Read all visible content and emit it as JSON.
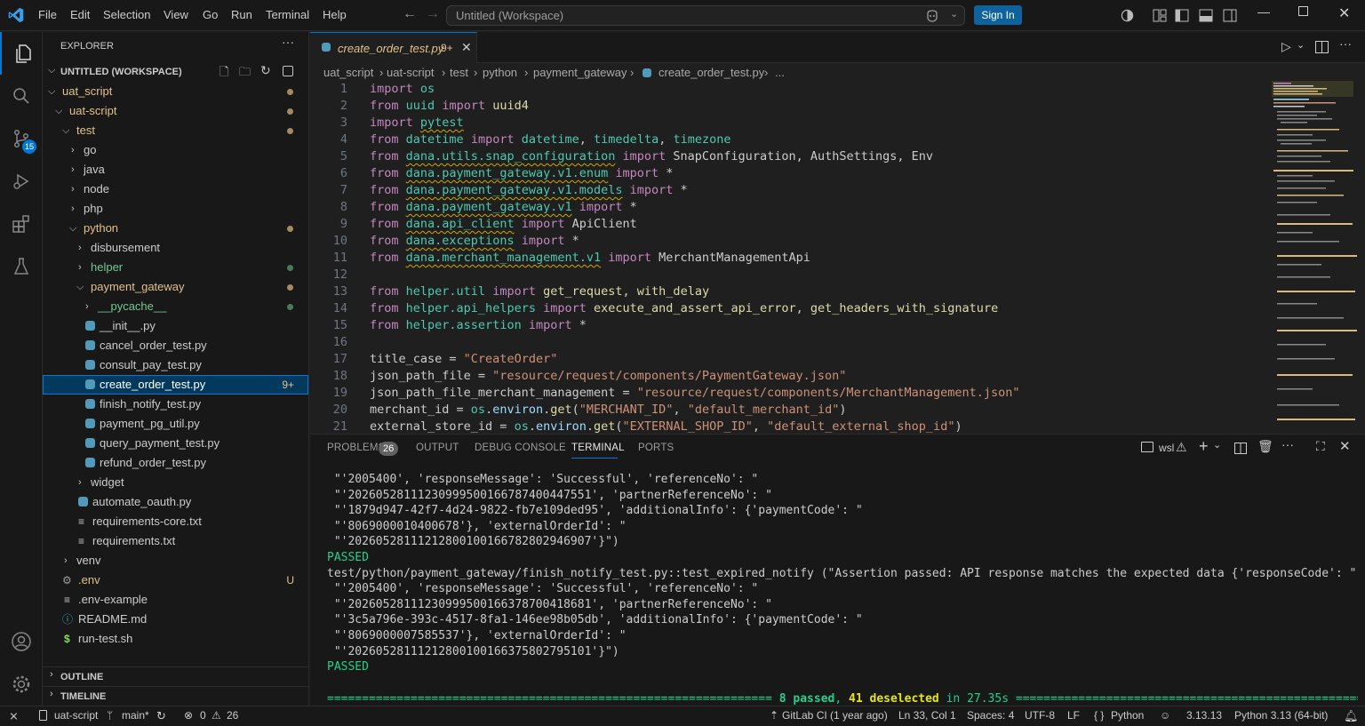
{
  "titlebar": {
    "menus": [
      "File",
      "Edit",
      "Selection",
      "View",
      "Go",
      "Run",
      "Terminal",
      "Help"
    ],
    "search_text": "Untitled (Workspace)",
    "signin_label": "Sign In"
  },
  "activity": {
    "scm_badge": "15"
  },
  "sidebar": {
    "title": "EXPLORER",
    "workspace": "UNTITLED (WORKSPACE)",
    "rows": [
      {
        "label": "uat_script",
        "depth": 1,
        "kind": "folder-open",
        "color": "#e2c08d",
        "dot": "#a68a5f"
      },
      {
        "label": "uat-script",
        "depth": 2,
        "kind": "folder-open",
        "color": "#e2c08d",
        "dot": "#a68a5f"
      },
      {
        "label": "test",
        "depth": 3,
        "kind": "folder-open",
        "color": "#e2c08d",
        "dot": "#a68a5f"
      },
      {
        "label": "go",
        "depth": 4,
        "kind": "folder",
        "color": "#cccccc"
      },
      {
        "label": "java",
        "depth": 4,
        "kind": "folder",
        "color": "#cccccc"
      },
      {
        "label": "node",
        "depth": 4,
        "kind": "folder",
        "color": "#cccccc"
      },
      {
        "label": "php",
        "depth": 4,
        "kind": "folder",
        "color": "#cccccc"
      },
      {
        "label": "python",
        "depth": 4,
        "kind": "folder-open",
        "color": "#e2c08d",
        "dot": "#a68a5f"
      },
      {
        "label": "disbursement",
        "depth": 5,
        "kind": "folder",
        "color": "#cccccc"
      },
      {
        "label": "helper",
        "depth": 5,
        "kind": "folder",
        "color": "#73c991",
        "dot": "#4b7a5a"
      },
      {
        "label": "payment_gateway",
        "depth": 5,
        "kind": "folder-open",
        "color": "#e2c08d",
        "dot": "#a68a5f"
      },
      {
        "label": "__pycache__",
        "depth": 6,
        "kind": "folder",
        "color": "#73c991",
        "dot": "#4b7a5a"
      },
      {
        "label": "__init__.py",
        "depth": 6,
        "kind": "py",
        "color": "#cccccc"
      },
      {
        "label": "cancel_order_test.py",
        "depth": 6,
        "kind": "py",
        "color": "#cccccc"
      },
      {
        "label": "consult_pay_test.py",
        "depth": 6,
        "kind": "py",
        "color": "#cccccc"
      },
      {
        "label": "create_order_test.py",
        "depth": 6,
        "kind": "py",
        "color": "#ffffff",
        "selected": true,
        "badge": "9+"
      },
      {
        "label": "finish_notify_test.py",
        "depth": 6,
        "kind": "py",
        "color": "#cccccc"
      },
      {
        "label": "payment_pg_util.py",
        "depth": 6,
        "kind": "py",
        "color": "#cccccc"
      },
      {
        "label": "query_payment_test.py",
        "depth": 6,
        "kind": "py",
        "color": "#cccccc"
      },
      {
        "label": "refund_order_test.py",
        "depth": 6,
        "kind": "py",
        "color": "#cccccc"
      },
      {
        "label": "widget",
        "depth": 5,
        "kind": "folder",
        "color": "#cccccc"
      },
      {
        "label": "automate_oauth.py",
        "depth": 5,
        "kind": "py",
        "color": "#cccccc"
      },
      {
        "label": "requirements-core.txt",
        "depth": 5,
        "kind": "txt",
        "color": "#cccccc"
      },
      {
        "label": "requirements.txt",
        "depth": 5,
        "kind": "txt",
        "color": "#cccccc"
      },
      {
        "label": "venv",
        "depth": 3,
        "kind": "folder",
        "color": "#cccccc"
      },
      {
        "label": ".env",
        "depth": 3,
        "kind": "gear",
        "color": "#e2c08d",
        "badge": "U"
      },
      {
        "label": ".env-example",
        "depth": 3,
        "kind": "txt",
        "color": "#cccccc"
      },
      {
        "label": "README.md",
        "depth": 3,
        "kind": "info",
        "color": "#cccccc"
      },
      {
        "label": "run-test.sh",
        "depth": 3,
        "kind": "sh",
        "color": "#cccccc"
      }
    ],
    "outline": "OUTLINE",
    "timeline": "TIMELINE"
  },
  "tab": {
    "label": "create_order_test.py",
    "badge": "9+"
  },
  "breadcrumb": [
    "uat_script",
    "uat-script",
    "test",
    "python",
    "payment_gateway",
    "create_order_test.py",
    "..."
  ],
  "code": [
    {
      "n": "1",
      "html": "<span class='kw'>import</span> <span class='mod'>os</span>"
    },
    {
      "n": "2",
      "html": "<span class='kw'>from</span> <span class='mod'>uuid</span> <span class='kw'>import</span> <span class='fn'>uuid4</span>"
    },
    {
      "n": "3",
      "html": "<span class='kw'>import</span> <span class='mod wavy'>pytest</span>"
    },
    {
      "n": "4",
      "html": "<span class='kw'>from</span> <span class='mod'>datetime</span> <span class='kw'>import</span> <span class='cls'>datetime</span>, <span class='cls'>timedelta</span>, <span class='cls'>timezone</span>"
    },
    {
      "n": "5",
      "html": "<span class='kw'>from</span> <span class='mod wavy'>dana.utils.snap_configuration</span> <span class='kw'>import</span> SnapConfiguration, AuthSettings, Env"
    },
    {
      "n": "6",
      "html": "<span class='kw'>from</span> <span class='mod wavy'>dana.payment_gateway.v1.enum</span> <span class='kw'>import</span> *"
    },
    {
      "n": "7",
      "html": "<span class='kw'>from</span> <span class='mod wavy'>dana.payment_gateway.v1.models</span> <span class='kw'>import</span> *"
    },
    {
      "n": "8",
      "html": "<span class='kw'>from</span> <span class='mod wavy'>dana.payment_gateway.v1</span> <span class='kw'>import</span> *"
    },
    {
      "n": "9",
      "html": "<span class='kw'>from</span> <span class='mod wavy'>dana.api_client</span> <span class='kw'>import</span> ApiClient"
    },
    {
      "n": "10",
      "html": "<span class='kw'>from</span> <span class='mod wavy'>dana.exceptions</span> <span class='kw'>import</span> *"
    },
    {
      "n": "11",
      "html": "<span class='kw'>from</span> <span class='mod wavy'>dana.merchant_management.v1</span> <span class='kw'>import</span> MerchantManagementApi"
    },
    {
      "n": "12",
      "html": ""
    },
    {
      "n": "13",
      "html": "<span class='kw'>from</span> <span class='mod'>helper.util</span> <span class='kw'>import</span> <span class='fn'>get_request</span>, <span class='fn'>with_delay</span>"
    },
    {
      "n": "14",
      "html": "<span class='kw'>from</span> <span class='mod'>helper.api_helpers</span> <span class='kw'>import</span> <span class='fn'>execute_and_assert_api_error</span>, <span class='fn'>get_headers_with_signature</span>"
    },
    {
      "n": "15",
      "html": "<span class='kw'>from</span> <span class='mod'>helper.assertion</span> <span class='kw'>import</span> *"
    },
    {
      "n": "16",
      "html": ""
    },
    {
      "n": "17",
      "html": "title_case = <span class='str'>\"CreateOrder\"</span>"
    },
    {
      "n": "18",
      "html": "json_path_file = <span class='str'>\"resource/request/components/PaymentGateway.json\"</span>"
    },
    {
      "n": "19",
      "html": "json_path_file_merchant_management = <span class='str'>\"resource/request/components/MerchantManagement.json\"</span>"
    },
    {
      "n": "20",
      "html": "merchant_id = <span class='mod'>os</span>.<span class='var'>environ</span>.<span class='fn'>get</span>(<span class='str'>\"MERCHANT_ID\"</span>, <span class='str'>\"default_merchant_id\"</span>)"
    },
    {
      "n": "21",
      "html": "external_store_id = <span class='mod'>os</span>.<span class='var'>environ</span>.<span class='fn'>get</span>(<span class='str'>\"EXTERNAL_SHOP_ID\"</span>, <span class='str'>\"default_external_shop_id\"</span>)"
    }
  ],
  "panel": {
    "tabs": [
      "PROBLEMS",
      "OUTPUT",
      "DEBUG CONSOLE",
      "TERMINAL",
      "PORTS"
    ],
    "problems_count": "26",
    "shell": "wsl",
    "terminal_lines": [
      {
        "text": " \"'2005400', 'responseMessage': 'Successful', 'referenceNo': \"",
        "cls": ""
      },
      {
        "text": " \"'20260528111230999500166787400447551', 'partnerReferenceNo': \"",
        "cls": ""
      },
      {
        "text": " \"'1879d947-42f7-4d24-9822-fb7e109ded95', 'additionalInfo': {'paymentCode': \"",
        "cls": ""
      },
      {
        "text": " \"'8069000010400678'}, 'externalOrderId': \"",
        "cls": ""
      },
      {
        "text": " \"'20260528111212800100166782802946907'}\")",
        "cls": ""
      },
      {
        "text": "PASSED",
        "cls": "passed"
      },
      {
        "text": "test/python/payment_gateway/finish_notify_test.py::test_expired_notify (\"Assertion passed: API response matches the expected data {'responseCode': \"",
        "cls": ""
      },
      {
        "text": " \"'2005400', 'responseMessage': 'Successful', 'referenceNo': \"",
        "cls": ""
      },
      {
        "text": " \"'20260528111230999500166378700418681', 'partnerReferenceNo': \"",
        "cls": ""
      },
      {
        "text": " \"'3c5a796e-393c-4517-8fa1-146ee98b05db', 'additionalInfo': {'paymentCode': \"",
        "cls": ""
      },
      {
        "text": " \"'8069000007585537'}, 'externalOrderId': \"",
        "cls": ""
      },
      {
        "text": " \"'20260528111212800100166375802795101'}\")",
        "cls": ""
      },
      {
        "text": "PASSED",
        "cls": "passed"
      },
      {
        "text": "",
        "cls": ""
      }
    ],
    "summary_left": "================================================================",
    "summary_passed": "8 passed",
    "summary_mid": ", ",
    "summary_deselected": "41 deselected",
    "summary_in": " in 27.35s ",
    "summary_right": "==============================================================="
  },
  "statusbar": {
    "folder": "uat-script",
    "branch": "main*",
    "errors": "0",
    "warnings": "26",
    "gitlab": "GitLab CI (1 year ago)",
    "position": "Ln 33, Col 1",
    "spaces": "Spaces: 4",
    "encoding": "UTF-8",
    "eol": "LF",
    "language": "Python",
    "py_version": "3.13.13",
    "interpreter": "Python 3.13 (64-bit)"
  }
}
